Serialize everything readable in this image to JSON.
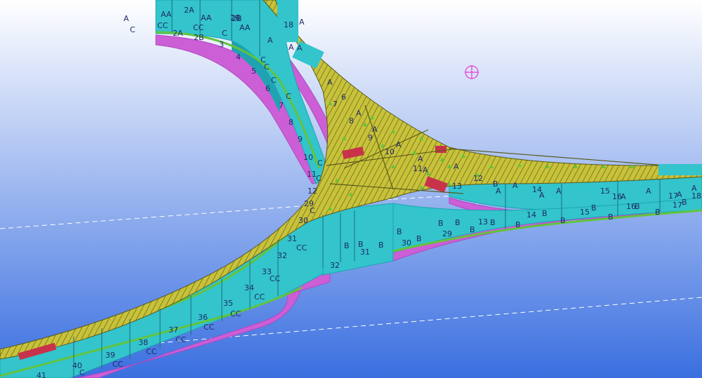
{
  "viewport": {
    "background_top": "#ffffff",
    "background_bottom": "#3a6fe0",
    "colors": {
      "deck": "#c8c23a",
      "deck_hatch": "#5a5a1a",
      "girder": "#33c4cc",
      "girder_dark": "#1fa3b0",
      "flange": "#cc5ed6",
      "flange_dark": "#b049c0",
      "edge_strip": "#62c43c",
      "red_plate": "#c8324a",
      "stiffener": "#1b6e7a",
      "gridline": "#ffffff",
      "reference_circle": "#e43ad8"
    },
    "grid_labels": [
      {
        "text": "A",
        "kind": "side"
      },
      {
        "text": "C",
        "kind": "side"
      },
      {
        "text": "AA",
        "kind": "side"
      },
      {
        "text": "CC",
        "kind": "side"
      },
      {
        "text": "2A",
        "kind": "grid"
      },
      {
        "text": "2B",
        "kind": "grid"
      },
      {
        "text": "AA",
        "kind": "side"
      },
      {
        "text": "2A",
        "kind": "grid"
      },
      {
        "text": "CC",
        "kind": "side"
      },
      {
        "text": "2B",
        "kind": "grid"
      },
      {
        "text": "C",
        "kind": "side"
      },
      {
        "text": "2B",
        "kind": "grid"
      },
      {
        "text": "AA",
        "kind": "side"
      },
      {
        "text": "3",
        "kind": "grid"
      },
      {
        "text": "A",
        "kind": "side"
      },
      {
        "text": "4",
        "kind": "grid"
      },
      {
        "text": "C",
        "kind": "side"
      },
      {
        "text": "5",
        "kind": "grid"
      },
      {
        "text": "C",
        "kind": "side"
      },
      {
        "text": "6",
        "kind": "grid"
      },
      {
        "text": "C",
        "kind": "side"
      },
      {
        "text": "7",
        "kind": "grid"
      },
      {
        "text": "C",
        "kind": "side"
      },
      {
        "text": "8",
        "kind": "grid"
      },
      {
        "text": "9",
        "kind": "grid"
      },
      {
        "text": "10",
        "kind": "grid"
      },
      {
        "text": "11",
        "kind": "grid"
      },
      {
        "text": "12",
        "kind": "grid"
      },
      {
        "text": "C",
        "kind": "side"
      },
      {
        "text": "C",
        "kind": "side"
      },
      {
        "text": "29",
        "kind": "grid"
      },
      {
        "text": "30",
        "kind": "grid"
      },
      {
        "text": "C",
        "kind": "side"
      },
      {
        "text": "31",
        "kind": "grid"
      },
      {
        "text": "CC",
        "kind": "side"
      },
      {
        "text": "32",
        "kind": "grid"
      },
      {
        "text": "33",
        "kind": "grid"
      },
      {
        "text": "CC",
        "kind": "side"
      },
      {
        "text": "34",
        "kind": "grid"
      },
      {
        "text": "CC",
        "kind": "side"
      },
      {
        "text": "35",
        "kind": "grid"
      },
      {
        "text": "CC",
        "kind": "side"
      },
      {
        "text": "36",
        "kind": "grid"
      },
      {
        "text": "CC",
        "kind": "side"
      },
      {
        "text": "37",
        "kind": "grid"
      },
      {
        "text": "CC",
        "kind": "side"
      },
      {
        "text": "38",
        "kind": "grid"
      },
      {
        "text": "CC",
        "kind": "side"
      },
      {
        "text": "39",
        "kind": "grid"
      },
      {
        "text": "CC",
        "kind": "side"
      },
      {
        "text": "40",
        "kind": "grid"
      },
      {
        "text": "C",
        "kind": "side"
      },
      {
        "text": "41",
        "kind": "grid"
      },
      {
        "text": "B",
        "kind": "side"
      },
      {
        "text": "B",
        "kind": "side"
      },
      {
        "text": "B",
        "kind": "side"
      },
      {
        "text": "B",
        "kind": "side"
      },
      {
        "text": "32",
        "kind": "grid"
      },
      {
        "text": "31",
        "kind": "grid"
      },
      {
        "text": "30",
        "kind": "grid"
      },
      {
        "text": "B",
        "kind": "side"
      },
      {
        "text": "B",
        "kind": "side"
      },
      {
        "text": "29",
        "kind": "grid"
      },
      {
        "text": "B",
        "kind": "side"
      },
      {
        "text": "B",
        "kind": "side"
      },
      {
        "text": "13",
        "kind": "grid"
      },
      {
        "text": "B",
        "kind": "side"
      },
      {
        "text": "B",
        "kind": "side"
      },
      {
        "text": "14",
        "kind": "grid"
      },
      {
        "text": "B",
        "kind": "side"
      },
      {
        "text": "B",
        "kind": "side"
      },
      {
        "text": "15",
        "kind": "grid"
      },
      {
        "text": "B",
        "kind": "side"
      },
      {
        "text": "B",
        "kind": "side"
      },
      {
        "text": "16",
        "kind": "grid"
      },
      {
        "text": "B",
        "kind": "side"
      },
      {
        "text": "B",
        "kind": "side"
      },
      {
        "text": "17",
        "kind": "grid"
      },
      {
        "text": "B",
        "kind": "side"
      },
      {
        "text": "B",
        "kind": "side"
      },
      {
        "text": "A",
        "kind": "side"
      },
      {
        "text": "A",
        "kind": "side"
      },
      {
        "text": "14",
        "kind": "grid"
      },
      {
        "text": "A",
        "kind": "side"
      },
      {
        "text": "A",
        "kind": "side"
      },
      {
        "text": "15",
        "kind": "grid"
      },
      {
        "text": "16",
        "kind": "grid"
      },
      {
        "text": "A",
        "kind": "side"
      },
      {
        "text": "A",
        "kind": "side"
      },
      {
        "text": "17",
        "kind": "grid"
      },
      {
        "text": "A",
        "kind": "side"
      },
      {
        "text": "A",
        "kind": "side"
      },
      {
        "text": "18",
        "kind": "grid"
      },
      {
        "text": "18",
        "kind": "grid"
      },
      {
        "text": "A",
        "kind": "side"
      },
      {
        "text": "A",
        "kind": "side"
      },
      {
        "text": "A",
        "kind": "side"
      },
      {
        "text": "A",
        "kind": "side"
      },
      {
        "text": "6",
        "kind": "grid"
      },
      {
        "text": "7",
        "kind": "grid"
      },
      {
        "text": "A",
        "kind": "side"
      },
      {
        "text": "8",
        "kind": "grid"
      },
      {
        "text": "A",
        "kind": "side"
      },
      {
        "text": "9",
        "kind": "grid"
      },
      {
        "text": "A",
        "kind": "side"
      },
      {
        "text": "10",
        "kind": "grid"
      },
      {
        "text": "A",
        "kind": "side"
      },
      {
        "text": "11",
        "kind": "grid"
      },
      {
        "text": "A",
        "kind": "side"
      },
      {
        "text": "A",
        "kind": "side"
      },
      {
        "text": "12",
        "kind": "grid"
      },
      {
        "text": "13",
        "kind": "grid"
      },
      {
        "text": "A",
        "kind": "side"
      }
    ]
  }
}
